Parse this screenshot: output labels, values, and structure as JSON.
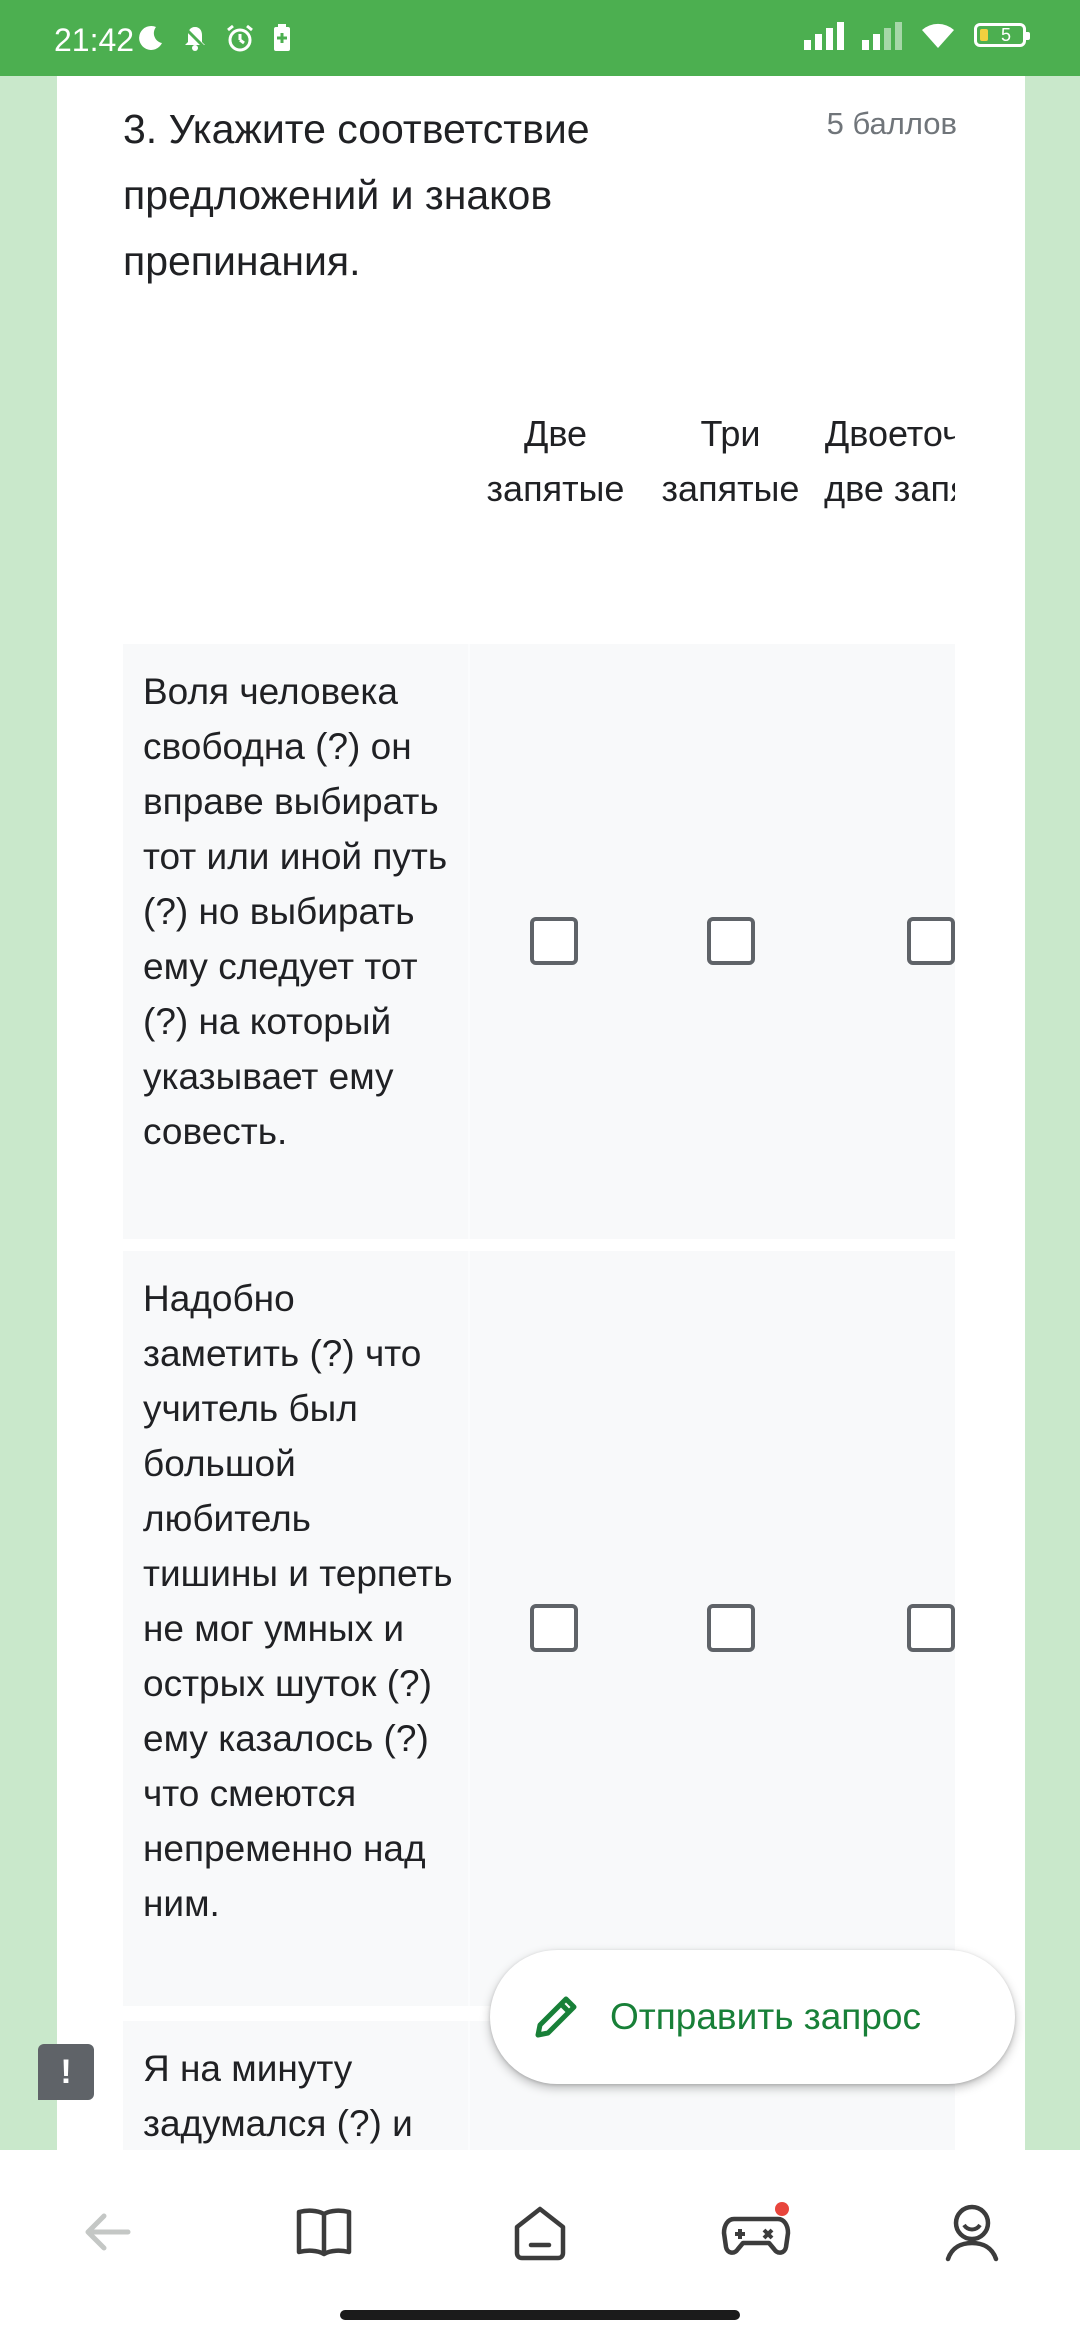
{
  "status_bar": {
    "time": "21:42",
    "battery_level": "5",
    "left_icons": [
      "moon-icon",
      "bell-off-icon",
      "alarm-icon",
      "battery-saver-icon"
    ],
    "right_icons": [
      "signal-icon",
      "signal-icon",
      "wifi-icon",
      "battery-icon"
    ]
  },
  "question": {
    "title": "3. Укажите соответствие предложений и знаков препинания.",
    "points": "5 баллов"
  },
  "grid": {
    "columns": [
      {
        "label": "Две запятые"
      },
      {
        "label": "Три запятые"
      },
      {
        "label": "Двоеточие и две запятые"
      }
    ],
    "rows": [
      {
        "label": "Воля человека свободна (?) он вправе выбирать тот или иной путь (?) но выбирать ему следует тот (?) на который указывает ему совесть.",
        "checked": [
          false,
          false,
          false
        ]
      },
      {
        "label": "Надобно заметить (?) что учитель был большой любитель тишины и терпеть не мог умных и острых шуток (?) ему казалось (?) что смеются непременно над ним.",
        "checked": [
          false,
          false,
          false
        ]
      },
      {
        "label": "Я на минуту задумался (?) и (?) когда снова",
        "checked": [
          false,
          false,
          false
        ]
      }
    ]
  },
  "fab": {
    "label": "Отправить запрос",
    "icon": "pencil-icon"
  },
  "report_button": {
    "label": "!"
  },
  "bottom_nav": {
    "items": [
      "back-arrow-icon",
      "book-icon",
      "home-icon",
      "gamepad-icon",
      "profile-icon"
    ]
  },
  "colors": {
    "status_bar": "#4caf50",
    "background": "#c9e8cb",
    "accent": "#188038"
  }
}
